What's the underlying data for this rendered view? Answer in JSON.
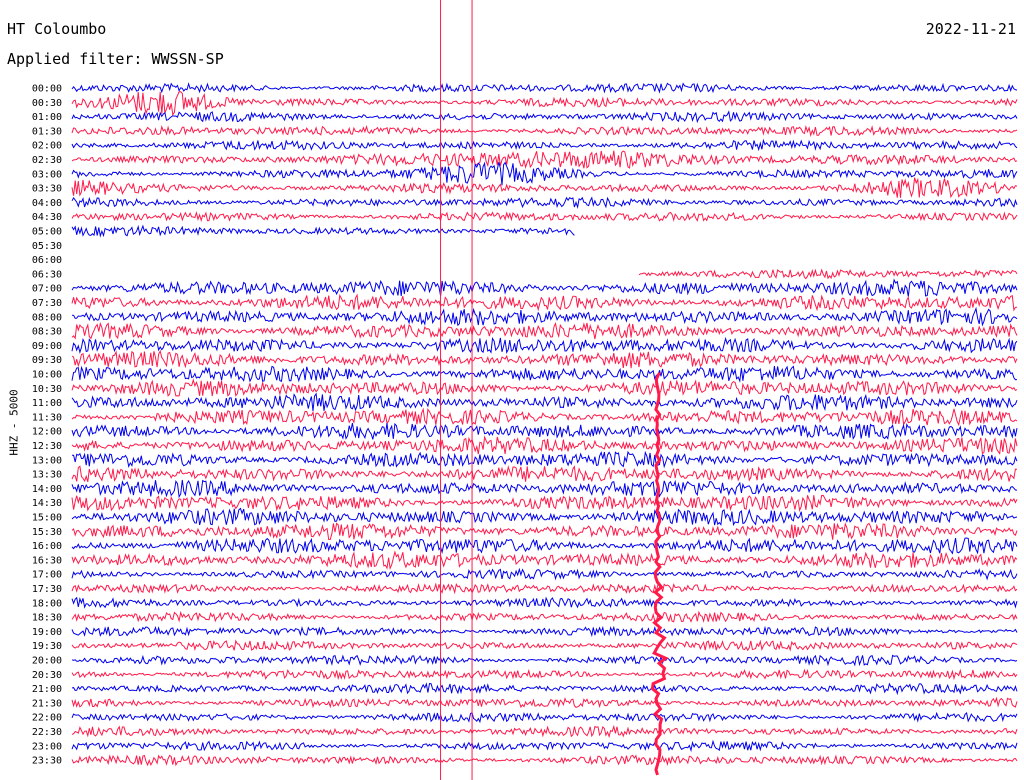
{
  "header": {
    "station": "HT Coloumbo",
    "filter": "Applied filter: WWSSN-SP",
    "date": "2022-11-21"
  },
  "colors": {
    "trace_a": "#0000ee",
    "trace_b": "#ff1a4a",
    "event_marker": "#ff1a4a"
  },
  "chart_data": {
    "type": "helicorder",
    "title": "HT Coloumbo",
    "subtitle": "Applied filter: WWSSN-SP",
    "date": "2022-11-21",
    "ylabel": "HHZ - 5000",
    "row_minutes": 30,
    "rows": [
      "00:00",
      "00:30",
      "01:00",
      "01:30",
      "02:00",
      "02:30",
      "03:00",
      "03:30",
      "04:00",
      "04:30",
      "05:00",
      "05:30",
      "06:00",
      "06:30",
      "07:00",
      "07:30",
      "08:00",
      "08:30",
      "09:00",
      "09:30",
      "10:00",
      "10:30",
      "11:00",
      "11:30",
      "12:00",
      "12:30",
      "13:00",
      "13:30",
      "14:00",
      "14:30",
      "15:00",
      "15:30",
      "16:00",
      "16:30",
      "17:00",
      "17:30",
      "18:00",
      "18:30",
      "19:00",
      "19:30",
      "20:00",
      "20:30",
      "21:00",
      "21:30",
      "22:00",
      "22:30",
      "23:00",
      "23:30"
    ],
    "trace_colors": [
      "blue",
      "red"
    ],
    "gap": {
      "start": "05:16",
      "end": "06:48"
    },
    "event_markers_minute_in_row": [
      11.7,
      12.7
    ],
    "large_event": {
      "row": "17:00",
      "minute_in_row": 18.6,
      "amplitude": "large"
    },
    "grid": false,
    "legend": "none"
  }
}
